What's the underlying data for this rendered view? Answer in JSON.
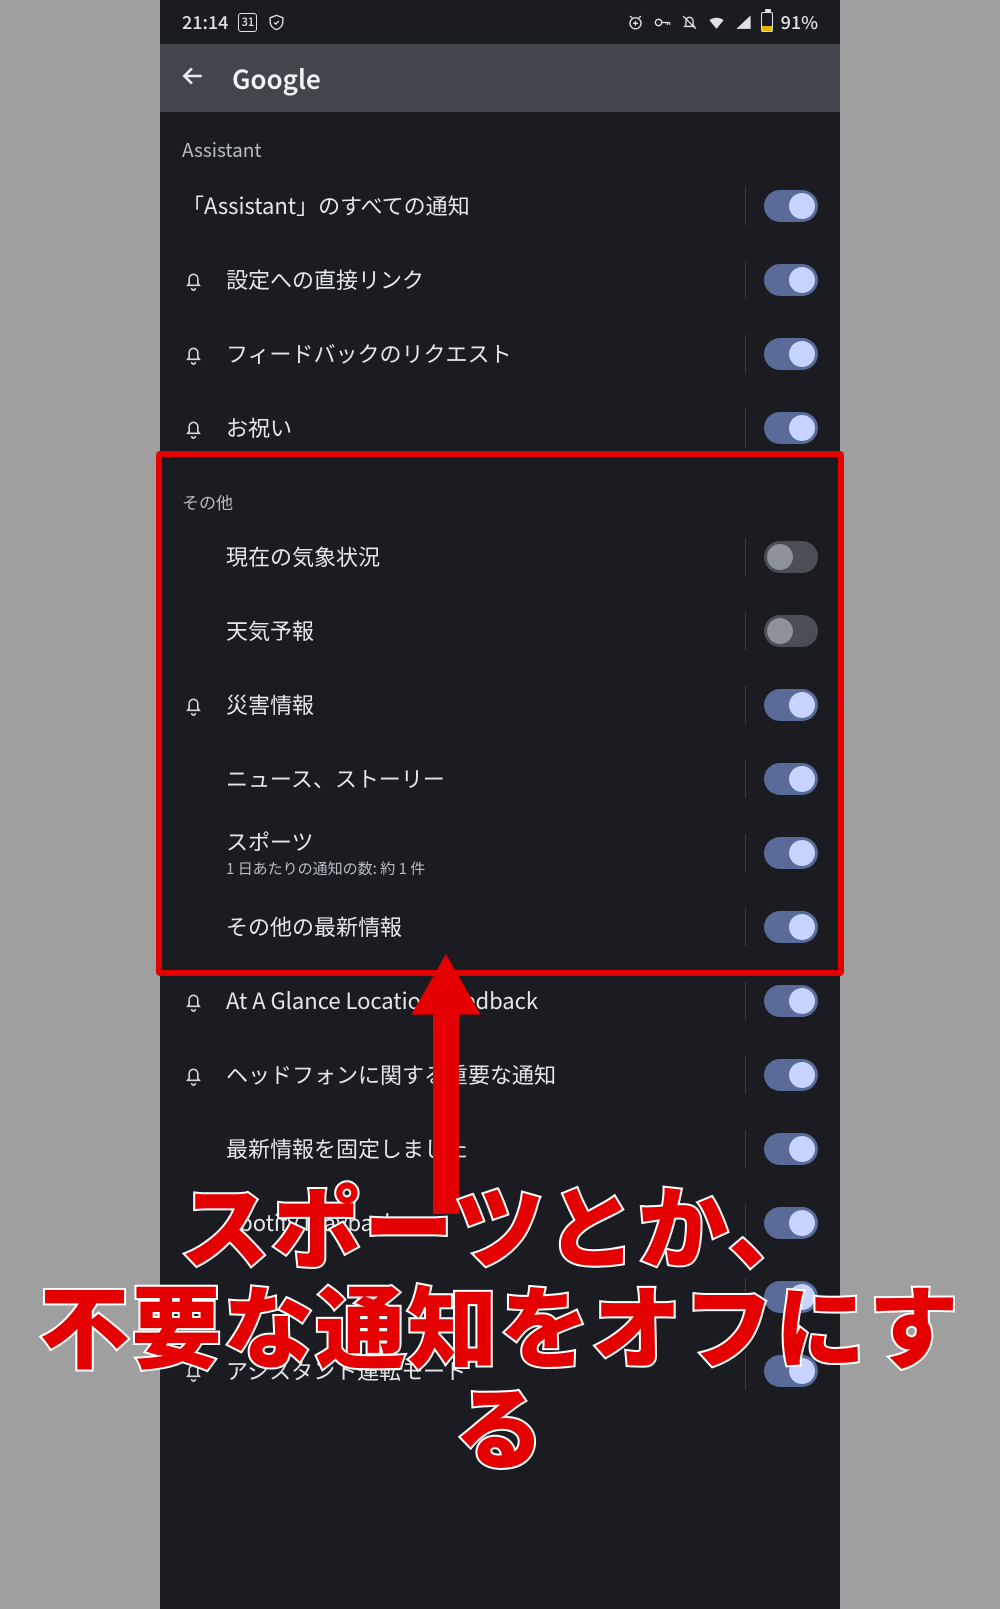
{
  "statusbar": {
    "time": "21:14",
    "calendar_date": "31",
    "battery_text": "91%"
  },
  "appbar": {
    "title": "Google"
  },
  "sections": [
    {
      "header": "Assistant",
      "items": [
        {
          "id": "assistant-all",
          "label": "「Assistant」のすべての通知",
          "has_bell": false,
          "toggle": true,
          "master": true
        },
        {
          "id": "settings-direct-link",
          "label": "設定への直接リンク",
          "has_bell": true,
          "toggle": true
        },
        {
          "id": "feedback-request",
          "label": "フィードバックのリクエスト",
          "has_bell": true,
          "toggle": true
        },
        {
          "id": "celebration",
          "label": "お祝い",
          "has_bell": true,
          "toggle": true
        }
      ]
    },
    {
      "header": "その他",
      "small_header": true,
      "highlighted": true,
      "items": [
        {
          "id": "current-weather",
          "label": "現在の気象状況",
          "has_bell": false,
          "toggle": false
        },
        {
          "id": "forecast",
          "label": "天気予報",
          "has_bell": false,
          "toggle": false
        },
        {
          "id": "disaster-info",
          "label": "災害情報",
          "has_bell": true,
          "toggle": true
        },
        {
          "id": "news-stories",
          "label": "ニュース、ストーリー",
          "has_bell": false,
          "toggle": true
        },
        {
          "id": "sports",
          "label": "スポーツ",
          "sub": "1 日あたりの通知の数: 約 1 件",
          "has_bell": false,
          "toggle": true
        },
        {
          "id": "other-latest",
          "label": "その他の最新情報",
          "has_bell": false,
          "toggle": true
        }
      ]
    },
    {
      "header": null,
      "items": [
        {
          "id": "glance-location-feedback",
          "label": "At A Glance Location Feedback",
          "has_bell": true,
          "toggle": true
        },
        {
          "id": "headphone-important",
          "label": "ヘッドフォンに関する重要な通知",
          "has_bell": true,
          "toggle": true
        },
        {
          "id": "latest-fixed",
          "label": "最新情報を固定しました",
          "has_bell": false,
          "toggle": true
        },
        {
          "id": "spotify-playback",
          "label": "Spotify Playback",
          "has_bell": false,
          "toggle": true
        },
        {
          "id": "blank-row",
          "label": "",
          "has_bell": false,
          "toggle": true,
          "blank": true
        },
        {
          "id": "assistant-driving-mode",
          "label": "アシスタント運転モード",
          "has_bell": true,
          "toggle": true
        }
      ]
    }
  ],
  "annotation": {
    "caption_line1": "スポーツとか、",
    "caption_line2": "不要な通知をオフにする"
  }
}
